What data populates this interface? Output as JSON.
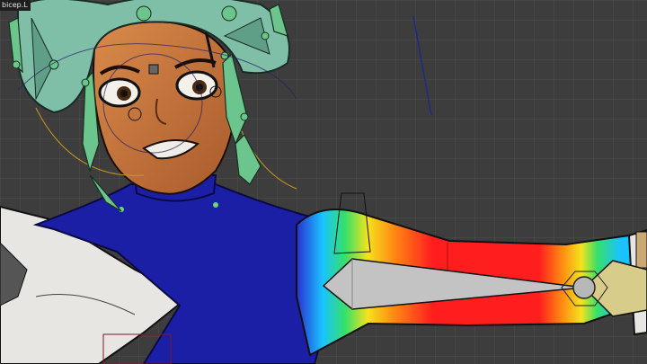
{
  "viewport": {
    "active_bone_label": "bicep.L",
    "mode": "weight-paint",
    "weight_gradient": [
      "#2a2fd1",
      "#19c3ff",
      "#35e06a",
      "#f5e21c",
      "#ff8a12",
      "#ff1e1e"
    ]
  }
}
